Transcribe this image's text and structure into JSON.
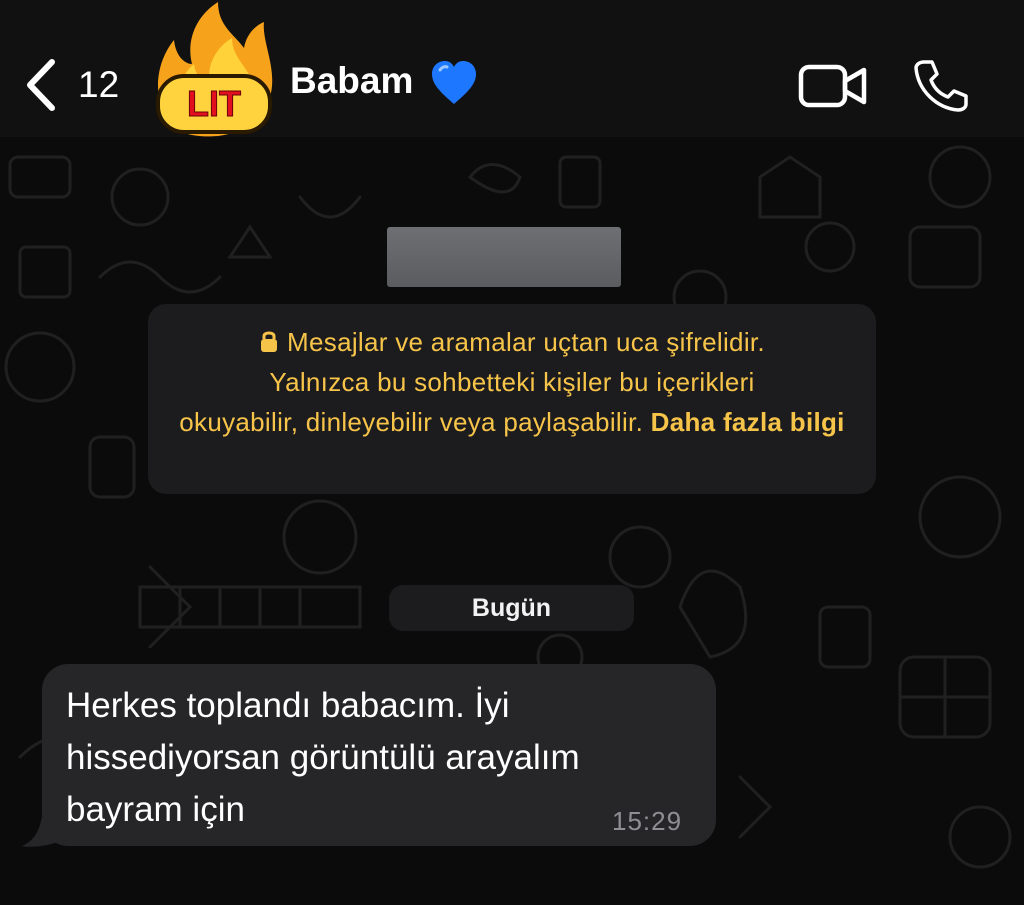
{
  "header": {
    "back_count": "12",
    "contact_name": "Babam",
    "avatar_sticker_text": "LIT",
    "icons": [
      "chevron-left-icon",
      "blue-heart-icon",
      "video-camera-icon",
      "phone-icon"
    ]
  },
  "encryption_notice": {
    "line1": "Mesajlar ve aramalar uçtan uca şifrelidir.",
    "line2": "Yalnızca bu sohbetteki kişiler bu içerikleri",
    "line3": "okuyabilir, dinleyebilir veya paylaşabilir.",
    "more_link": "Daha fazla bilgi"
  },
  "date_separator": "Bugün",
  "messages": [
    {
      "lines": [
        "Herkes toplandı babacım. İyi",
        "hissediyorsan görüntülü arayalım",
        "bayram için"
      ],
      "time": "15:29",
      "direction": "incoming"
    }
  ],
  "colors": {
    "accent_yellow": "#f7c44a",
    "bubble_bg": "#262628",
    "header_bg": "#111111",
    "background": "#0b0b0b"
  }
}
